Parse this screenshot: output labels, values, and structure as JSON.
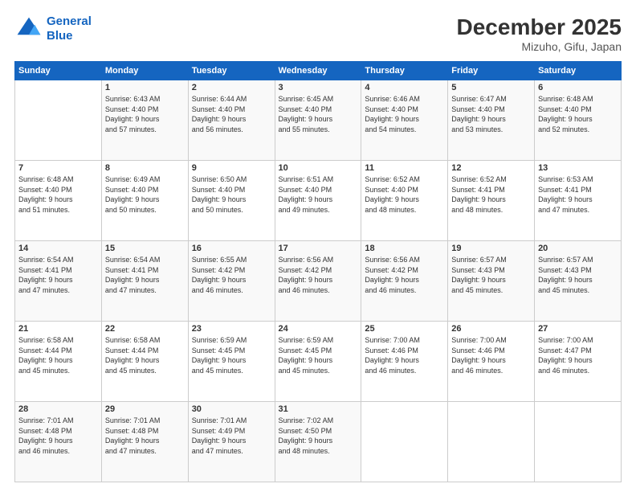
{
  "header": {
    "logo_line1": "General",
    "logo_line2": "Blue",
    "title": "December 2025",
    "location": "Mizuho, Gifu, Japan"
  },
  "days_of_week": [
    "Sunday",
    "Monday",
    "Tuesday",
    "Wednesday",
    "Thursday",
    "Friday",
    "Saturday"
  ],
  "weeks": [
    [
      {
        "day": "",
        "info": ""
      },
      {
        "day": "1",
        "info": "Sunrise: 6:43 AM\nSunset: 4:40 PM\nDaylight: 9 hours\nand 57 minutes."
      },
      {
        "day": "2",
        "info": "Sunrise: 6:44 AM\nSunset: 4:40 PM\nDaylight: 9 hours\nand 56 minutes."
      },
      {
        "day": "3",
        "info": "Sunrise: 6:45 AM\nSunset: 4:40 PM\nDaylight: 9 hours\nand 55 minutes."
      },
      {
        "day": "4",
        "info": "Sunrise: 6:46 AM\nSunset: 4:40 PM\nDaylight: 9 hours\nand 54 minutes."
      },
      {
        "day": "5",
        "info": "Sunrise: 6:47 AM\nSunset: 4:40 PM\nDaylight: 9 hours\nand 53 minutes."
      },
      {
        "day": "6",
        "info": "Sunrise: 6:48 AM\nSunset: 4:40 PM\nDaylight: 9 hours\nand 52 minutes."
      }
    ],
    [
      {
        "day": "7",
        "info": "Sunrise: 6:48 AM\nSunset: 4:40 PM\nDaylight: 9 hours\nand 51 minutes."
      },
      {
        "day": "8",
        "info": "Sunrise: 6:49 AM\nSunset: 4:40 PM\nDaylight: 9 hours\nand 50 minutes."
      },
      {
        "day": "9",
        "info": "Sunrise: 6:50 AM\nSunset: 4:40 PM\nDaylight: 9 hours\nand 50 minutes."
      },
      {
        "day": "10",
        "info": "Sunrise: 6:51 AM\nSunset: 4:40 PM\nDaylight: 9 hours\nand 49 minutes."
      },
      {
        "day": "11",
        "info": "Sunrise: 6:52 AM\nSunset: 4:40 PM\nDaylight: 9 hours\nand 48 minutes."
      },
      {
        "day": "12",
        "info": "Sunrise: 6:52 AM\nSunset: 4:41 PM\nDaylight: 9 hours\nand 48 minutes."
      },
      {
        "day": "13",
        "info": "Sunrise: 6:53 AM\nSunset: 4:41 PM\nDaylight: 9 hours\nand 47 minutes."
      }
    ],
    [
      {
        "day": "14",
        "info": "Sunrise: 6:54 AM\nSunset: 4:41 PM\nDaylight: 9 hours\nand 47 minutes."
      },
      {
        "day": "15",
        "info": "Sunrise: 6:54 AM\nSunset: 4:41 PM\nDaylight: 9 hours\nand 47 minutes."
      },
      {
        "day": "16",
        "info": "Sunrise: 6:55 AM\nSunset: 4:42 PM\nDaylight: 9 hours\nand 46 minutes."
      },
      {
        "day": "17",
        "info": "Sunrise: 6:56 AM\nSunset: 4:42 PM\nDaylight: 9 hours\nand 46 minutes."
      },
      {
        "day": "18",
        "info": "Sunrise: 6:56 AM\nSunset: 4:42 PM\nDaylight: 9 hours\nand 46 minutes."
      },
      {
        "day": "19",
        "info": "Sunrise: 6:57 AM\nSunset: 4:43 PM\nDaylight: 9 hours\nand 45 minutes."
      },
      {
        "day": "20",
        "info": "Sunrise: 6:57 AM\nSunset: 4:43 PM\nDaylight: 9 hours\nand 45 minutes."
      }
    ],
    [
      {
        "day": "21",
        "info": "Sunrise: 6:58 AM\nSunset: 4:44 PM\nDaylight: 9 hours\nand 45 minutes."
      },
      {
        "day": "22",
        "info": "Sunrise: 6:58 AM\nSunset: 4:44 PM\nDaylight: 9 hours\nand 45 minutes."
      },
      {
        "day": "23",
        "info": "Sunrise: 6:59 AM\nSunset: 4:45 PM\nDaylight: 9 hours\nand 45 minutes."
      },
      {
        "day": "24",
        "info": "Sunrise: 6:59 AM\nSunset: 4:45 PM\nDaylight: 9 hours\nand 45 minutes."
      },
      {
        "day": "25",
        "info": "Sunrise: 7:00 AM\nSunset: 4:46 PM\nDaylight: 9 hours\nand 46 minutes."
      },
      {
        "day": "26",
        "info": "Sunrise: 7:00 AM\nSunset: 4:46 PM\nDaylight: 9 hours\nand 46 minutes."
      },
      {
        "day": "27",
        "info": "Sunrise: 7:00 AM\nSunset: 4:47 PM\nDaylight: 9 hours\nand 46 minutes."
      }
    ],
    [
      {
        "day": "28",
        "info": "Sunrise: 7:01 AM\nSunset: 4:48 PM\nDaylight: 9 hours\nand 46 minutes."
      },
      {
        "day": "29",
        "info": "Sunrise: 7:01 AM\nSunset: 4:48 PM\nDaylight: 9 hours\nand 47 minutes."
      },
      {
        "day": "30",
        "info": "Sunrise: 7:01 AM\nSunset: 4:49 PM\nDaylight: 9 hours\nand 47 minutes."
      },
      {
        "day": "31",
        "info": "Sunrise: 7:02 AM\nSunset: 4:50 PM\nDaylight: 9 hours\nand 48 minutes."
      },
      {
        "day": "",
        "info": ""
      },
      {
        "day": "",
        "info": ""
      },
      {
        "day": "",
        "info": ""
      }
    ]
  ]
}
